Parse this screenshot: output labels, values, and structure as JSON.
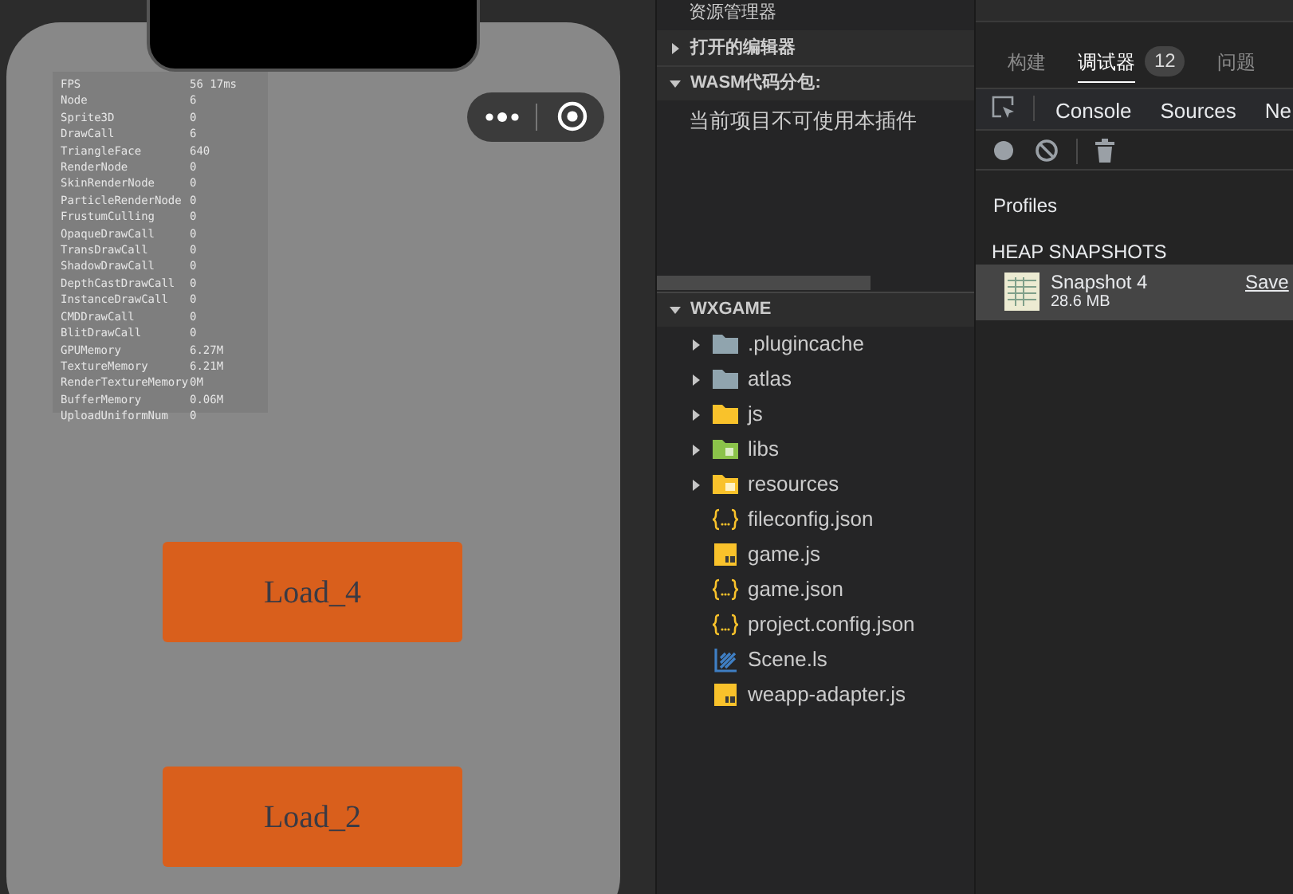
{
  "simulator": {
    "stats": [
      {
        "name": "FPS",
        "value": "56 17ms"
      },
      {
        "name": "Node",
        "value": "6"
      },
      {
        "name": "Sprite3D",
        "value": "0"
      },
      {
        "name": "DrawCall",
        "value": "6"
      },
      {
        "name": "TriangleFace",
        "value": "640"
      },
      {
        "name": "RenderNode",
        "value": "0"
      },
      {
        "name": "SkinRenderNode",
        "value": "0"
      },
      {
        "name": "ParticleRenderNode",
        "value": "0"
      },
      {
        "name": "FrustumCulling",
        "value": "0"
      },
      {
        "name": "OpaqueDrawCall",
        "value": "0"
      },
      {
        "name": "TransDrawCall",
        "value": "0"
      },
      {
        "name": "ShadowDrawCall",
        "value": "0"
      },
      {
        "name": "DepthCastDrawCall",
        "value": "0"
      },
      {
        "name": "InstanceDrawCall",
        "value": "0"
      },
      {
        "name": "CMDDrawCall",
        "value": "0"
      },
      {
        "name": "BlitDrawCall",
        "value": "0"
      },
      {
        "name": "GPUMemory",
        "value": "6.27M"
      },
      {
        "name": "TextureMemory",
        "value": "6.21M"
      },
      {
        "name": "RenderTextureMemory",
        "value": "0M"
      },
      {
        "name": "BufferMemory",
        "value": "0.06M"
      },
      {
        "name": "UploadUniformNum",
        "value": "0"
      }
    ],
    "buttons": [
      "Load_4",
      "Load_2"
    ]
  },
  "explorer": {
    "title": "资源管理器",
    "sections": [
      {
        "label": "打开的编辑器",
        "expanded": false
      },
      {
        "label": "WASM代码分包:",
        "expanded": true
      }
    ],
    "wasm_message": "当前项目不可使用本插件",
    "project": {
      "label": "WXGAME",
      "expanded": true,
      "items": [
        {
          "label": ".plugincache",
          "kind": "folder"
        },
        {
          "label": "atlas",
          "kind": "folder"
        },
        {
          "label": "js",
          "kind": "jsfolder"
        },
        {
          "label": "libs",
          "kind": "libfolder"
        },
        {
          "label": "resources",
          "kind": "resfolder"
        },
        {
          "label": "fileconfig.json",
          "kind": "json"
        },
        {
          "label": "game.js",
          "kind": "js"
        },
        {
          "label": "game.json",
          "kind": "json"
        },
        {
          "label": "project.config.json",
          "kind": "json"
        },
        {
          "label": "Scene.ls",
          "kind": "scene"
        },
        {
          "label": "weapp-adapter.js",
          "kind": "js"
        }
      ]
    }
  },
  "devtools": {
    "tabs": [
      {
        "label": "构建",
        "selected": false
      },
      {
        "label": "调试器",
        "selected": true,
        "badge": "12"
      },
      {
        "label": "问题",
        "selected": false
      }
    ],
    "panel_tabs": [
      {
        "label": "Console"
      },
      {
        "label": "Sources"
      },
      {
        "label": "Ne"
      }
    ],
    "profiles_title": "Profiles",
    "heap_title": "HEAP SNAPSHOTS",
    "snapshot": {
      "name": "Snapshot 4",
      "size": "28.6 MB",
      "action": "Save",
      "selected": true
    }
  }
}
